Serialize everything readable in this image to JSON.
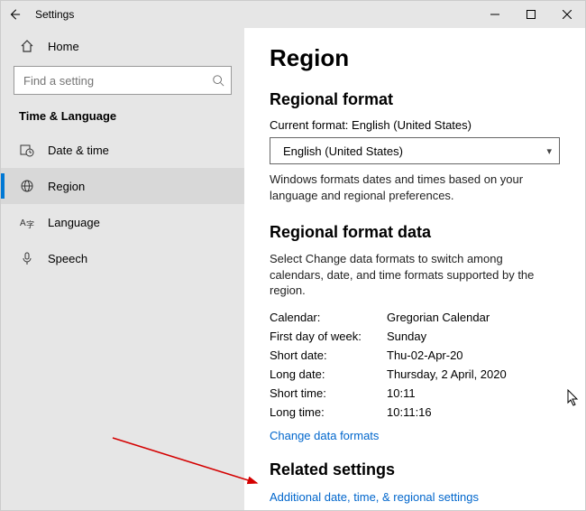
{
  "titlebar": {
    "title": "Settings"
  },
  "sidebar": {
    "home": "Home",
    "search_placeholder": "Find a setting",
    "group": "Time & Language",
    "items": [
      {
        "label": "Date & time"
      },
      {
        "label": "Region"
      },
      {
        "label": "Language"
      },
      {
        "label": "Speech"
      }
    ]
  },
  "page": {
    "heading": "Region",
    "section1_title": "Regional format",
    "current_format_label": "Current format: English (United States)",
    "dropdown_value": "English (United States)",
    "section1_desc": "Windows formats dates and times based on your language and regional preferences.",
    "section2_title": "Regional format data",
    "section2_desc": "Select Change data formats to switch among calendars, date, and time formats supported by the region.",
    "rows": {
      "calendar_k": "Calendar:",
      "calendar_v": "Gregorian Calendar",
      "firstday_k": "First day of week:",
      "firstday_v": "Sunday",
      "shortdate_k": "Short date:",
      "shortdate_v": "Thu-02-Apr-20",
      "longdate_k": "Long date:",
      "longdate_v": "Thursday, 2 April, 2020",
      "shorttime_k": "Short time:",
      "shorttime_v": "10:11",
      "longtime_k": "Long time:",
      "longtime_v": "10:11:16"
    },
    "change_link": "Change data formats",
    "related_title": "Related settings",
    "related_link": "Additional date, time, & regional settings"
  }
}
